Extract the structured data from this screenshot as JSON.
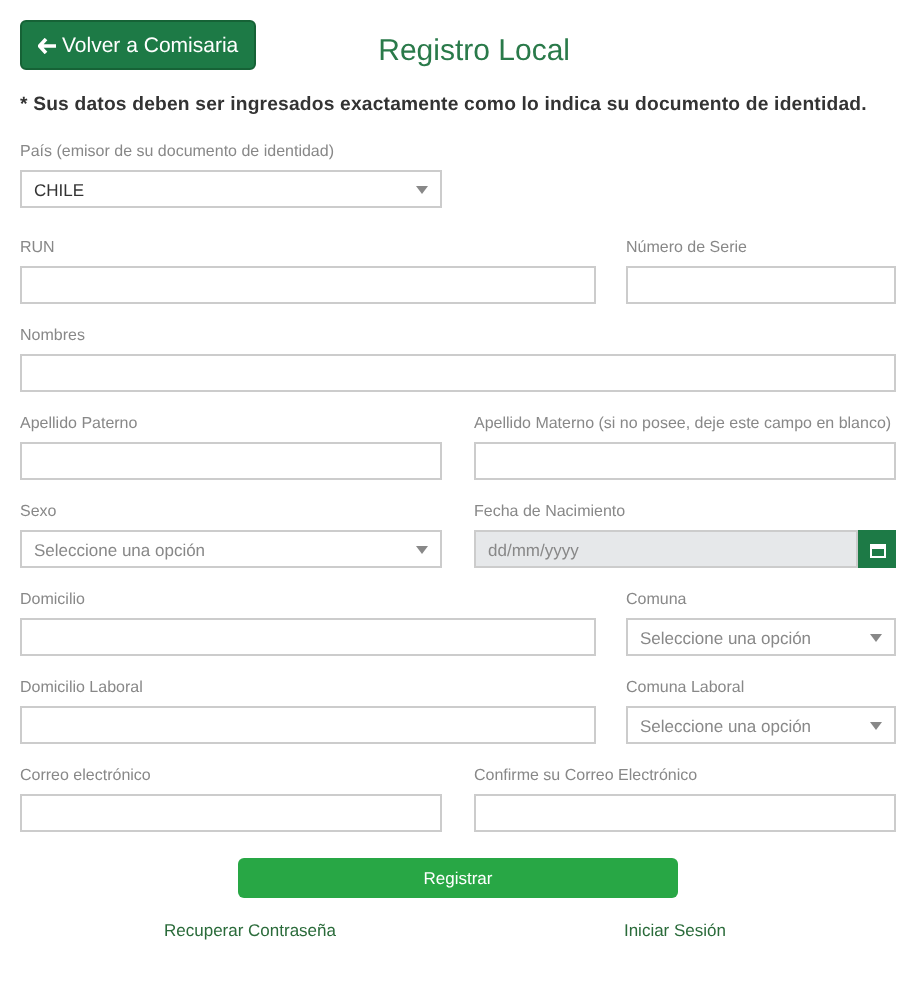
{
  "back_button": {
    "label": "Volver a Comisaria"
  },
  "title": "Registro Local",
  "notice": "* Sus datos deben ser ingresados exactamente como lo indica su documento de identidad.",
  "rows": [
    [
      {
        "label": "País (emisor de su documento de identidad)",
        "kind": "select",
        "value": "CHILE"
      }
    ],
    [
      {
        "label": "RUN",
        "kind": "text"
      },
      {
        "label": "Número de Serie",
        "kind": "text"
      }
    ],
    [
      {
        "label": "Nombres",
        "kind": "text"
      }
    ],
    [
      {
        "label": "Apellido Paterno",
        "kind": "text"
      },
      {
        "label": "Apellido Materno (si no posee, deje este campo en blanco)",
        "kind": "text"
      }
    ],
    [
      {
        "label": "Sexo",
        "kind": "select",
        "placeholder": "Seleccione una opción"
      },
      {
        "label": "Fecha de Nacimiento",
        "kind": "date",
        "placeholder": "dd/mm/yyyy",
        "disabled": true
      }
    ],
    [
      {
        "label": "Domicilio",
        "kind": "text"
      },
      {
        "label": "Comuna",
        "kind": "select",
        "placeholder": "Seleccione una opción"
      }
    ],
    [
      {
        "label": "Domicilio Laboral",
        "kind": "text"
      },
      {
        "label": "Comuna Laboral",
        "kind": "select",
        "placeholder": "Seleccione una opción"
      }
    ],
    [
      {
        "label": "Correo electrónico",
        "kind": "text"
      },
      {
        "label": "Confirme su Correo Electrónico",
        "kind": "text"
      }
    ]
  ],
  "submit_button": {
    "label": "Registrar"
  },
  "links": [
    "Recuperar Contraseña",
    "Iniciar Sesión"
  ]
}
